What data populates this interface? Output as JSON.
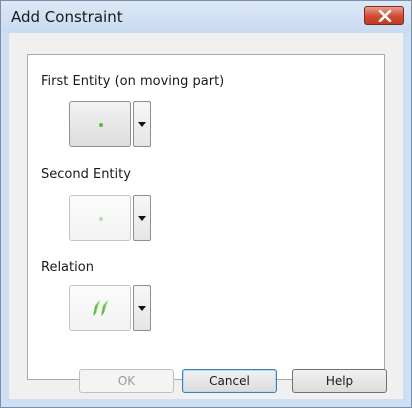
{
  "window": {
    "title": "Add Constraint"
  },
  "fields": [
    {
      "label": "First Entity (on moving part)",
      "icon": "point-icon",
      "state": "enabled"
    },
    {
      "label": "Second Entity",
      "icon": "point-icon",
      "state": "inactive"
    },
    {
      "label": "Relation",
      "icon": "parallel-relation-icon",
      "state": "inactive"
    }
  ],
  "buttons": {
    "ok": "OK",
    "cancel": "Cancel",
    "help": "Help"
  },
  "colors": {
    "accent": "#3c7fb1",
    "point": "#4cc23a",
    "close": "#cf4a33"
  }
}
